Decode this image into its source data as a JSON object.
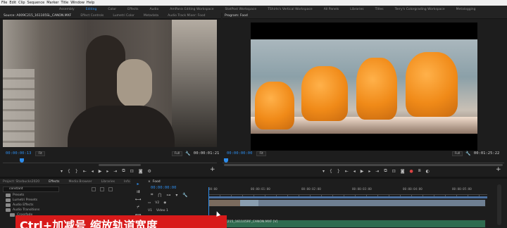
{
  "menubar": [
    "File",
    "Edit",
    "Clip",
    "Sequence",
    "Marker",
    "Title",
    "Window",
    "Help"
  ],
  "workspaces": [
    {
      "label": "Assembly",
      "active": false
    },
    {
      "label": "Editing",
      "active": true
    },
    {
      "label": "Color",
      "active": false
    },
    {
      "label": "Effects",
      "active": false
    },
    {
      "label": "Audio",
      "active": false
    },
    {
      "label": "AmPanis Editing Workspace",
      "active": false
    },
    {
      "label": "StatPost Workspace",
      "active": false
    },
    {
      "label": "TShirts's Vertical Workspace",
      "active": false
    },
    {
      "label": "All Panels",
      "active": false
    },
    {
      "label": "Libraries",
      "active": false
    },
    {
      "label": "Titles",
      "active": false
    },
    {
      "label": "Terry's Colorgrading Workspace",
      "active": false
    },
    {
      "label": "Metalogging",
      "active": false
    }
  ],
  "source_panel": {
    "tabs": [
      "Source: A009C215_161105SL_CANON.MXF",
      "Effect Controls",
      "Lumetri Color",
      "Metadata",
      "Audio Track Mixer: Food"
    ],
    "timecode_in": "00:00:00:13",
    "fit": "Fit",
    "resolution": "Full",
    "timecode_duration": "00:00:01:21"
  },
  "program_panel": {
    "tabs": [
      "Program: Food"
    ],
    "timecode_in": "00:00:00:00",
    "fit": "Fit",
    "resolution": "Full",
    "timecode_duration": "00:01:25:22"
  },
  "transport_icons": [
    "marker-icon",
    "mark-in-icon",
    "mark-out-icon",
    "go-to-in-icon",
    "step-back-icon",
    "play-icon",
    "step-forward-icon",
    "go-to-out-icon",
    "insert-icon",
    "overwrite-icon",
    "export-frame-icon",
    "settings-icon"
  ],
  "project_panel": {
    "tabs": [
      "Project: Starbucks2020",
      "Effects",
      "Media Browser",
      "Libraries",
      "Info"
    ],
    "search_value": "constant",
    "tree": [
      {
        "label": "Presets",
        "indent": 0
      },
      {
        "label": "Lumetri Presets",
        "indent": 0
      },
      {
        "label": "Audio Effects",
        "indent": 0
      },
      {
        "label": "Audio Transitions",
        "indent": 0
      },
      {
        "label": "Crossfade",
        "indent": 1
      }
    ]
  },
  "timeline": {
    "sequence_name": "Food",
    "timecode": "00:00:00:00",
    "ruler": [
      "00:00",
      "00:00:01:00",
      "00:00:02:00",
      "00:00:03:00",
      "00:00:04:00",
      "00:00:05:00"
    ],
    "tracks": [
      {
        "name": "V2",
        "label": ""
      },
      {
        "name": "V1",
        "label": "Video 1"
      }
    ],
    "audio_clip_label": "A009C215_161105RF_CANON.MXF [V]"
  },
  "caption": "Ctrl+加减号 缩放轨道宽度"
}
